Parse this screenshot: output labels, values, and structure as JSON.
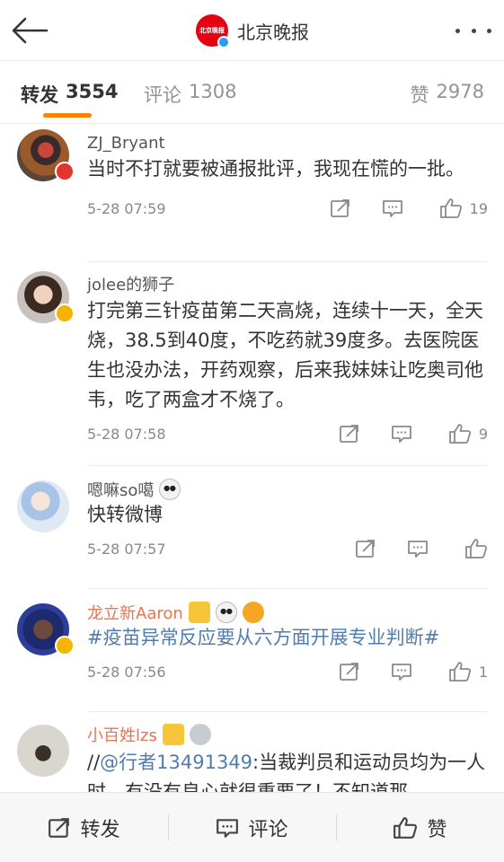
{
  "header": {
    "account_name": "北京晚报",
    "account_logo_text": "北京晚报",
    "back_icon": "back-arrow-icon",
    "more_icon": "more-dots-icon"
  },
  "tabs": [
    {
      "label": "转发",
      "count": "3554",
      "active": true
    },
    {
      "label": "评论",
      "count": "1308",
      "active": false
    },
    {
      "label": "赞",
      "count": "2978",
      "active": false
    }
  ],
  "comments": [
    {
      "username": "ZJ_Bryant",
      "content": "当时不打就要被通报批评，我现在慌的一批。",
      "time": "5-28 07:59",
      "likes": "19"
    },
    {
      "username": "jolee的狮子",
      "content": "打完第三针疫苗第二天高烧，连续十一天，全天烧，38.5到40度，不吃药就39度多。去医院医生也没办法，开药观察，后来我妹妹让吃奥司他韦，吃了两盒才不烧了。",
      "time": "5-28 07:58",
      "likes": "9"
    },
    {
      "username": "嗯嘛so噶",
      "content": "快转微博",
      "time": "5-28 07:57",
      "likes": ""
    },
    {
      "username": "龙立新Aaron",
      "content": "#疫苗异常反应要从六方面开展专业判断#",
      "time": "5-28 07:56",
      "likes": "1"
    },
    {
      "username": "小百姓lzs",
      "content_prefix": "//",
      "mention": "@行者13491349",
      "content_rest": ":当裁判员和运动员均为一人时，有没有良心就很重要了！不知道那"
    }
  ],
  "bottom_bar": {
    "repost_label": "转发",
    "comment_label": "评论",
    "like_label": "赞"
  },
  "colors": {
    "accent": "#ff8200",
    "link": "#507daf",
    "vip_name": "#eb7350"
  }
}
